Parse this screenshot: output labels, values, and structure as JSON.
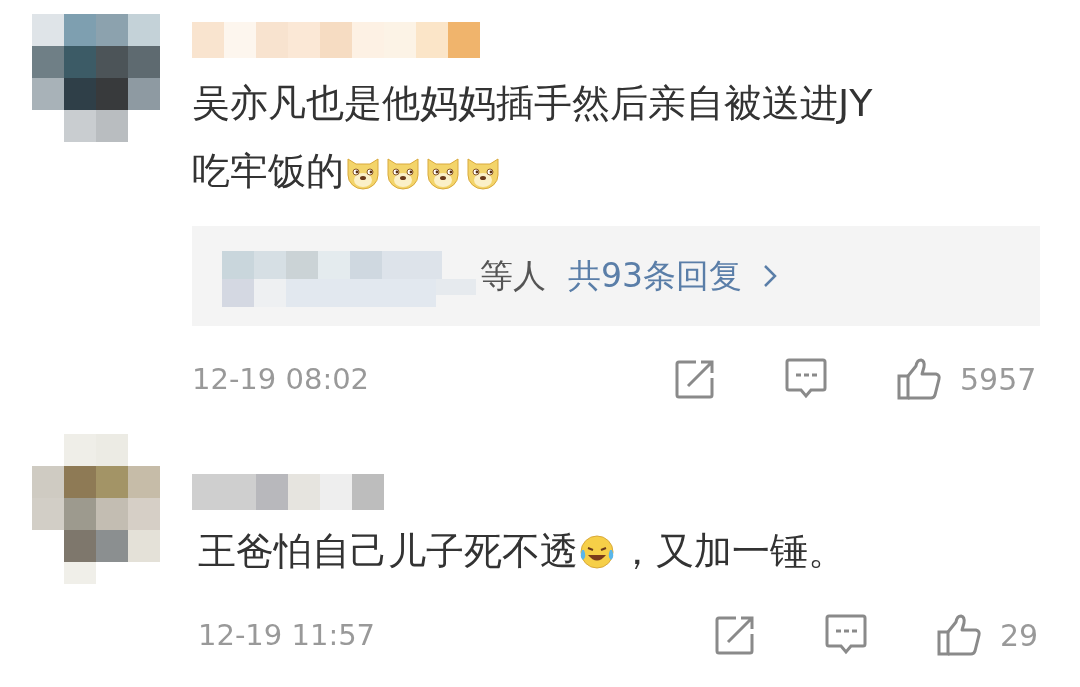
{
  "comments": [
    {
      "avatar": {
        "kind": "picture"
      },
      "lines": [
        [
          {
            "kind": "text",
            "text": "吴亦凡也是他妈妈插手然后亲自被送进JY"
          }
        ],
        [
          {
            "kind": "text",
            "text": "吃牢饭的"
          },
          {
            "kind": "doge"
          },
          {
            "kind": "doge"
          },
          {
            "kind": "doge"
          },
          {
            "kind": "doge"
          }
        ]
      ],
      "replies": {
        "names_suffix": "等人",
        "count_link": "共93条回复"
      },
      "time": "12-19 08:02",
      "likes": "5957"
    },
    {
      "avatar": {
        "kind": "picture"
      },
      "lines": [
        [
          {
            "kind": "text",
            "text": "王爸怕自己儿子死不透"
          },
          {
            "kind": "laughcry"
          },
          {
            "kind": "text",
            "text": "，又加一锤。"
          }
        ]
      ],
      "time": "12-19 11:57",
      "likes": "29"
    }
  ]
}
